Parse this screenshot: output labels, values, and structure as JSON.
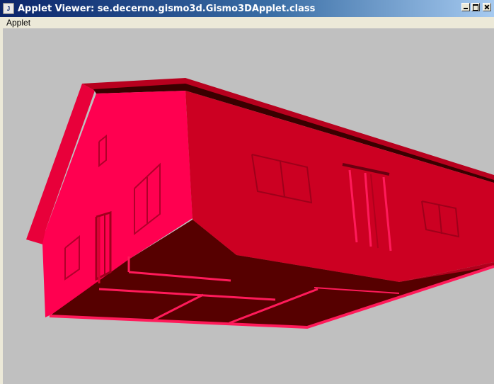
{
  "window": {
    "title": "Applet Viewer: se.decerno.gismo3d.Gismo3DApplet.class",
    "icon": "java-applet-icon",
    "controls": [
      "minimize-icon",
      "maximize-icon",
      "close-icon"
    ]
  },
  "menubar": {
    "items": [
      {
        "label": "Applet"
      }
    ]
  },
  "scene": {
    "background_color": "#c0c0c0",
    "model": "3d-house-upside-down",
    "colors": {
      "bright": "#ff0050",
      "mid": "#d5002a",
      "dark": "#a80018",
      "floor": "#560000",
      "edge": "#3a0000"
    }
  }
}
